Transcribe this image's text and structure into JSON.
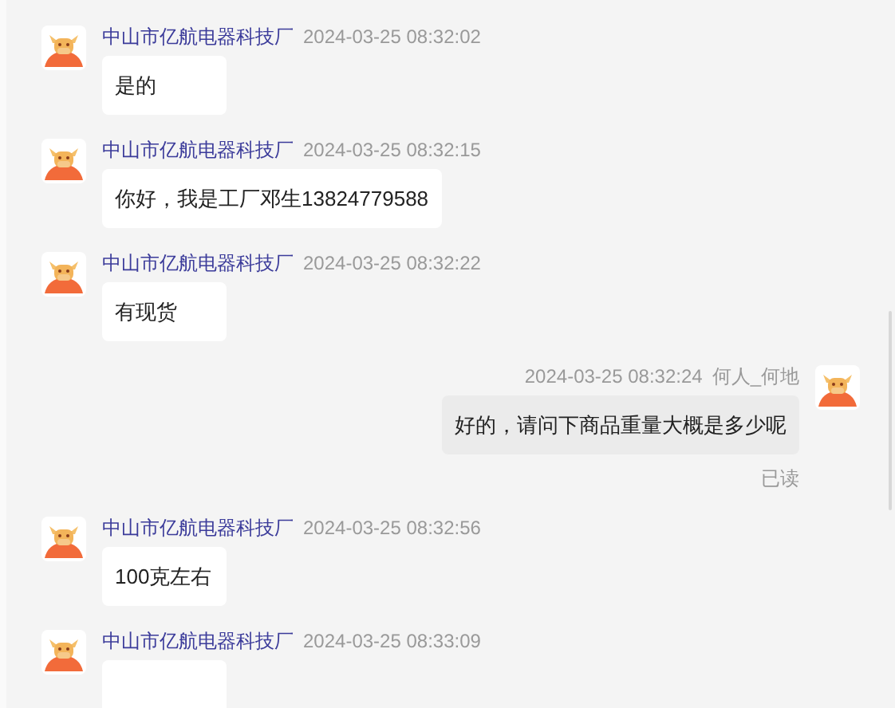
{
  "messages": [
    {
      "kind": "incoming",
      "sender": "中山市亿航电器科技厂",
      "time": "2024-03-25 08:32:02",
      "text": "是的"
    },
    {
      "kind": "incoming",
      "sender": "中山市亿航电器科技厂",
      "time": "2024-03-25 08:32:15",
      "text": "你好，我是工厂邓生13824779588"
    },
    {
      "kind": "incoming",
      "sender": "中山市亿航电器科技厂",
      "time": "2024-03-25 08:32:22",
      "text": "有现货"
    },
    {
      "kind": "outgoing",
      "sender": "何人_何地",
      "time": "2024-03-25 08:32:24",
      "text": "好的，请问下商品重量大概是多少呢",
      "status": "已读"
    },
    {
      "kind": "incoming",
      "sender": "中山市亿航电器科技厂",
      "time": "2024-03-25 08:32:56",
      "text": "100克左右"
    },
    {
      "kind": "incoming",
      "sender": "中山市亿航电器科技厂",
      "time": "2024-03-25 08:33:09"
    }
  ]
}
